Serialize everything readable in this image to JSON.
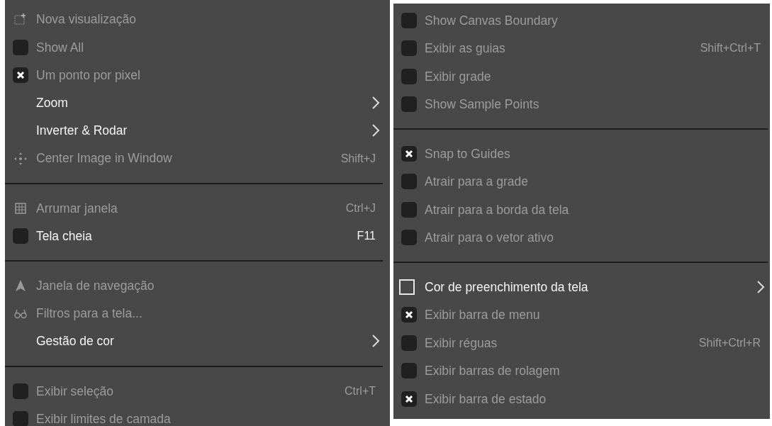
{
  "menus": [
    {
      "sections": [
        {
          "items": [
            {
              "kind": "icon",
              "label": "Nova visualização",
              "disabled": true
            },
            {
              "kind": "checkbox",
              "label": "Show All",
              "checked": false,
              "disabled": true
            },
            {
              "kind": "checkbox",
              "label": "Um ponto por pixel",
              "checked": true,
              "disabled": true
            },
            {
              "kind": "plain",
              "label": "Zoom",
              "disabled": false,
              "submenu": true
            },
            {
              "kind": "plain",
              "label": "Inverter & Rodar",
              "disabled": false,
              "submenu": true
            },
            {
              "kind": "icon",
              "label": "Center Image in Window",
              "disabled": true,
              "shortcut": "Shift+J"
            }
          ]
        },
        {
          "items": [
            {
              "kind": "icon",
              "label": "Arrumar janela",
              "disabled": true,
              "shortcut": "Ctrl+J"
            },
            {
              "kind": "checkbox",
              "label": "Tela cheia",
              "checked": false,
              "disabled": false,
              "shortcut": "F11"
            }
          ]
        },
        {
          "items": [
            {
              "kind": "icon",
              "label": "Janela de navegação",
              "disabled": true
            },
            {
              "kind": "icon",
              "label": "Filtros para a tela...",
              "disabled": true
            },
            {
              "kind": "plain",
              "label": "Gestão de cor",
              "disabled": false,
              "submenu": true
            }
          ]
        },
        {
          "items": [
            {
              "kind": "checkbox",
              "label": "Exibir seleção",
              "checked": false,
              "disabled": true,
              "shortcut": "Ctrl+T"
            },
            {
              "kind": "checkbox",
              "label": "Exibir limites de camada",
              "checked": false,
              "disabled": true
            }
          ]
        }
      ]
    },
    {
      "sections": [
        {
          "items": [
            {
              "kind": "checkbox",
              "label": "Show Canvas Boundary",
              "checked": false,
              "disabled": true
            },
            {
              "kind": "checkbox",
              "label": "Exibir as guias",
              "checked": false,
              "disabled": true,
              "shortcut": "Shift+Ctrl+T"
            },
            {
              "kind": "checkbox",
              "label": "Exibir grade",
              "checked": false,
              "disabled": true
            },
            {
              "kind": "checkbox",
              "label": "Show Sample Points",
              "checked": false,
              "disabled": true
            }
          ]
        },
        {
          "items": [
            {
              "kind": "checkbox",
              "label": "Snap to Guides",
              "checked": true,
              "disabled": true
            },
            {
              "kind": "checkbox",
              "label": "Atrair para a grade",
              "checked": false,
              "disabled": true
            },
            {
              "kind": "checkbox",
              "label": "Atrair para a borda da tela",
              "checked": false,
              "disabled": true
            },
            {
              "kind": "checkbox",
              "label": "Atrair para o vetor ativo",
              "checked": false,
              "disabled": true
            }
          ]
        },
        {
          "items": [
            {
              "kind": "swatch",
              "label": "Cor de preenchimento da tela",
              "disabled": false,
              "submenu": true
            },
            {
              "kind": "checkbox",
              "label": "Exibir barra de menu",
              "checked": true,
              "disabled": true
            },
            {
              "kind": "checkbox",
              "label": "Exibir réguas",
              "checked": false,
              "disabled": true,
              "shortcut": "Shift+Ctrl+R"
            },
            {
              "kind": "checkbox",
              "label": "Exibir barras de rolagem",
              "checked": false,
              "disabled": true
            },
            {
              "kind": "checkbox",
              "label": "Exibir barra de estado",
              "checked": true,
              "disabled": true
            }
          ]
        }
      ]
    }
  ]
}
